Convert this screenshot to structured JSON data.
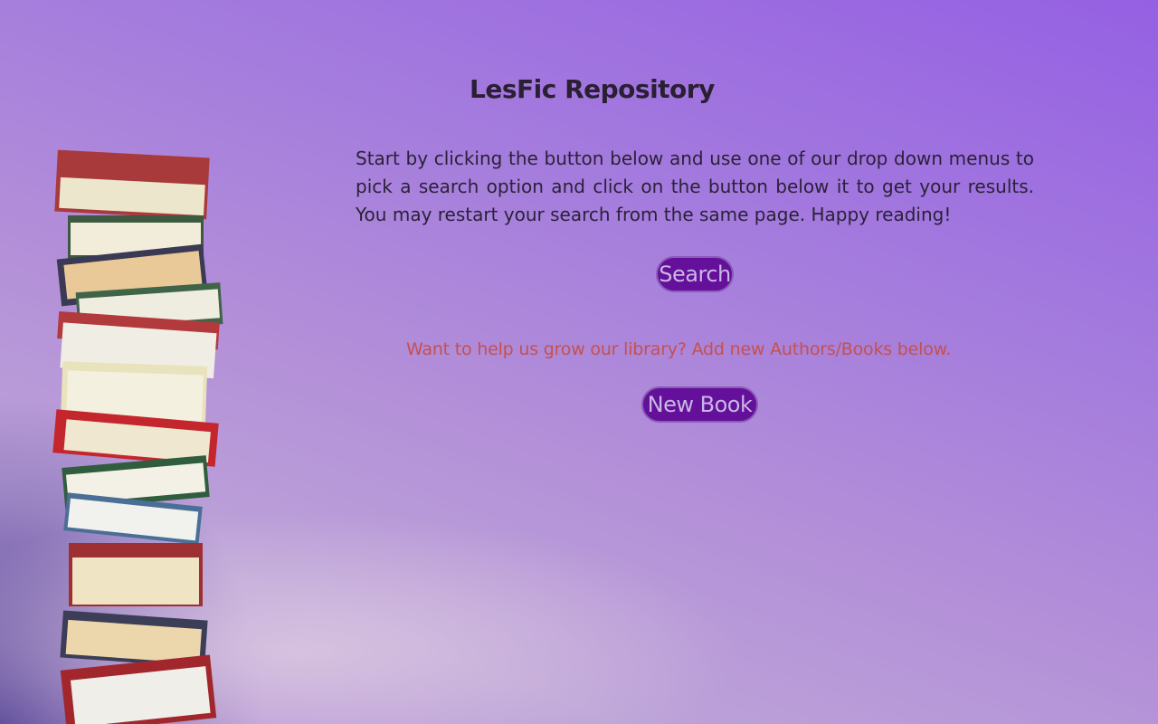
{
  "page": {
    "title": "LesFic Repository",
    "intro": "Start by clicking the button below and use one of our drop down menus to pick a search option and click on the button below it to get your results. You may restart your search from the same page. Happy reading!",
    "search_label": "Search",
    "promo_text": "Want to help us grow our library? Add new Authors/Books below.",
    "new_book_label": "New Book"
  },
  "colors": {
    "button_bg": "#64109a",
    "button_text": "#c9b7e6",
    "promo_text": "#c5504f",
    "heading_text": "#2a1f33"
  },
  "decor": {
    "image": "book-stack-illustration"
  }
}
